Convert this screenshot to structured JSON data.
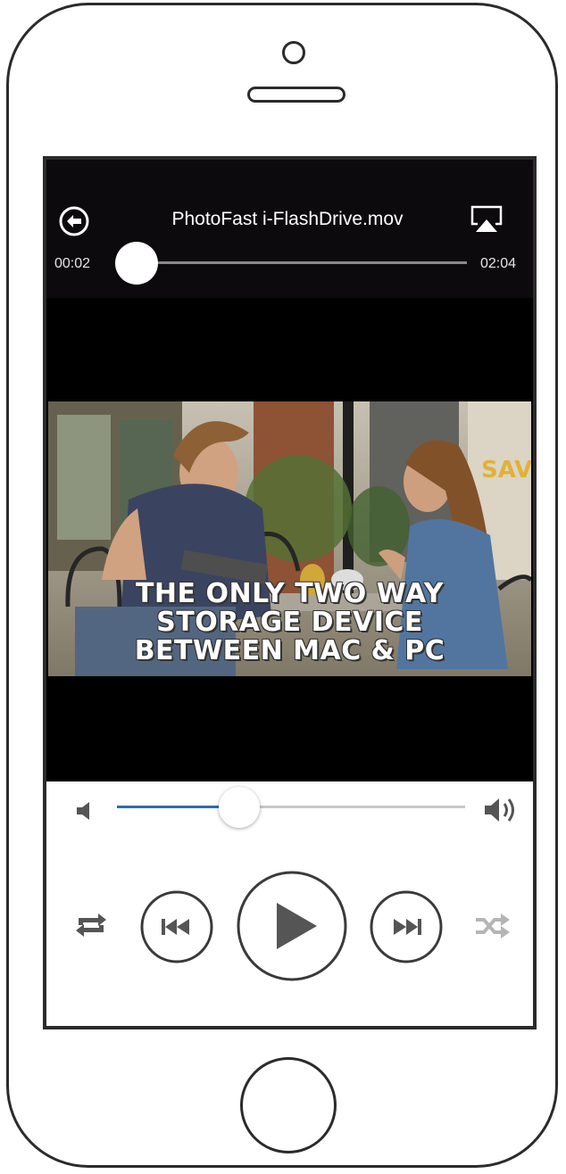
{
  "player": {
    "title": "PhotoFast i-FlashDrive.mov",
    "elapsed": "00:02",
    "total": "02:04",
    "progress_fraction": 0.016
  },
  "video": {
    "caption_lines": [
      "THE ONLY TWO WAY",
      "STORAGE DEVICE",
      "BETWEEN MAC & PC"
    ]
  },
  "volume": {
    "level_fraction": 0.35
  },
  "icons": {
    "back": "back-arrow-circle-icon",
    "airplay": "airplay-icon",
    "volume_low": "speaker-low-icon",
    "volume_high": "speaker-high-icon",
    "repeat": "repeat-icon",
    "previous": "skip-previous-icon",
    "play": "play-icon",
    "next": "skip-next-icon",
    "shuffle": "shuffle-icon"
  },
  "colors": {
    "progress_fill": "#d8322e",
    "volume_fill": "#2b6db3",
    "control_gray": "#555555"
  }
}
